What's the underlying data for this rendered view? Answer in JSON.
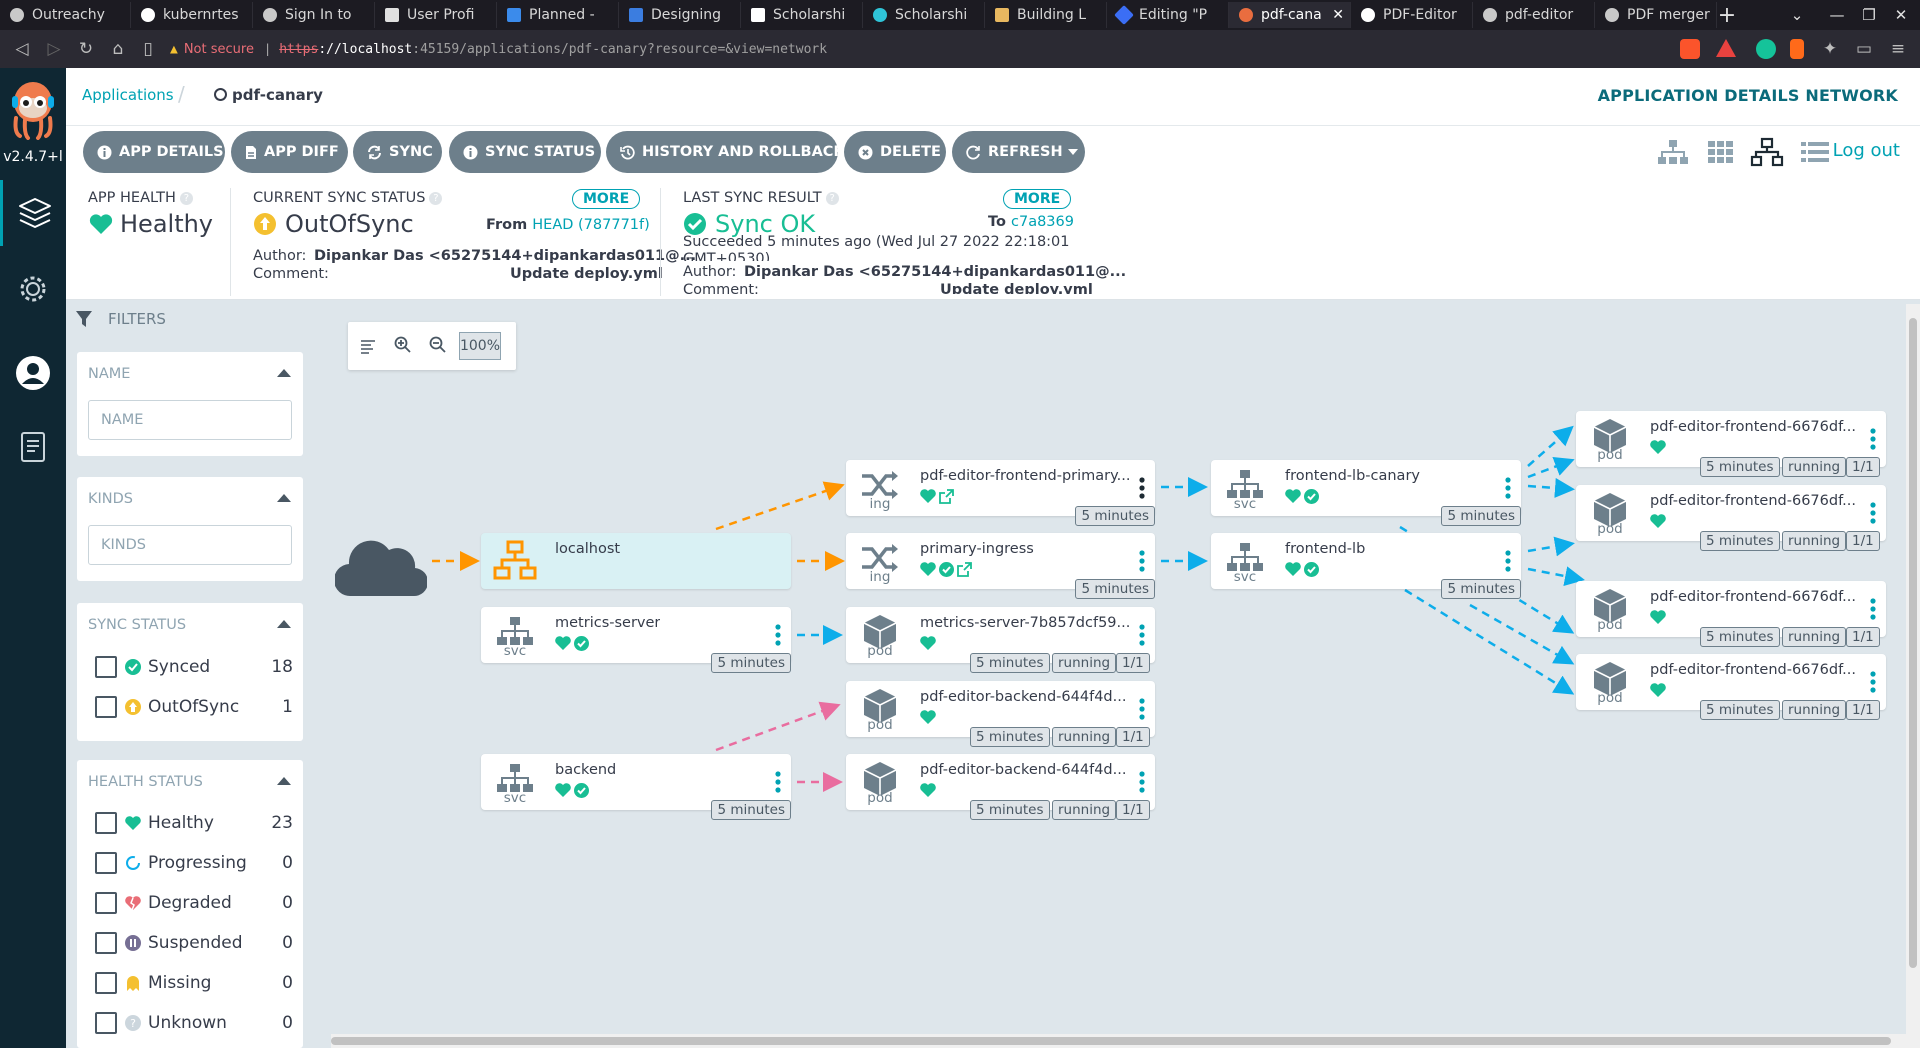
{
  "browser": {
    "tabs": [
      {
        "label": "Outreachy"
      },
      {
        "label": "kubernrtes"
      },
      {
        "label": "Sign In to"
      },
      {
        "label": "User Profi"
      },
      {
        "label": "Planned -"
      },
      {
        "label": "Designing"
      },
      {
        "label": "Scholarshi"
      },
      {
        "label": "Scholarshi"
      },
      {
        "label": "Building L"
      },
      {
        "label": "Editing \"P"
      },
      {
        "label": "pdf-cana"
      },
      {
        "label": "PDF-Editor"
      },
      {
        "label": "pdf-editor"
      },
      {
        "label": "PDF merger"
      }
    ],
    "security_label": "Not secure",
    "url_scheme": "https",
    "url_host": "://localhost",
    "url_rest": ":45159/applications/pdf-canary?resource=&view=network"
  },
  "sidebar": {
    "version": "v2.4.7+l",
    "items": [
      {
        "icon": "layers-icon"
      },
      {
        "icon": "settings-gear-icon"
      },
      {
        "icon": "user-icon"
      },
      {
        "icon": "docs-icon"
      }
    ]
  },
  "header": {
    "breadcrumb_root": "Applications",
    "breadcrumb_sep": "/",
    "app_name": "pdf-canary",
    "view_title": "APPLICATION DETAILS NETWORK",
    "logout": "Log out"
  },
  "toolbar": {
    "buttons": [
      {
        "label": "APP DETAILS",
        "icon": "info-icon"
      },
      {
        "label": "APP DIFF",
        "icon": "file-icon"
      },
      {
        "label": "SYNC",
        "icon": "sync-icon"
      },
      {
        "label": "SYNC STATUS",
        "icon": "info-icon"
      },
      {
        "label": "HISTORY AND ROLLBACK",
        "icon": "history-icon"
      },
      {
        "label": "DELETE",
        "icon": "close-circle-icon"
      },
      {
        "label": "REFRESH",
        "icon": "refresh-icon"
      }
    ]
  },
  "status": {
    "app_health_label": "APP HEALTH",
    "app_health_value": "Healthy",
    "sync_label": "CURRENT SYNC STATUS",
    "sync_value": "OutOfSync",
    "sync_more": "MORE",
    "sync_from_prefix": "From",
    "sync_from_ref": "HEAD (787771f)",
    "sync_author_label": "Author:",
    "sync_author": "Dipankar Das <65275144+dipankardas011@...",
    "sync_comment_label": "Comment:",
    "sync_comment": "Update deploy.yml",
    "last_label": "LAST SYNC RESULT",
    "last_value": "Sync OK",
    "last_more": "MORE",
    "last_to_prefix": "To",
    "last_to_ref": "c7a8369",
    "last_succeeded": "Succeeded 5 minutes ago (Wed Jul 27 2022 22:18:01",
    "last_succeeded_tz": "GMT+0530)",
    "last_author_label": "Author:",
    "last_author": "Dipankar Das <65275144+dipankardas011@...",
    "last_comment_label": "Comment:",
    "last_comment": "Update deploy.yml"
  },
  "filters": {
    "title": "FILTERS",
    "name_header": "NAME",
    "name_placeholder": "NAME",
    "kinds_header": "KINDS",
    "kinds_placeholder": "KINDS",
    "sync_header": "SYNC STATUS",
    "sync_items": [
      {
        "label": "Synced",
        "count": "18"
      },
      {
        "label": "OutOfSync",
        "count": "1"
      }
    ],
    "health_header": "HEALTH STATUS",
    "health_items": [
      {
        "label": "Healthy",
        "count": "23"
      },
      {
        "label": "Progressing",
        "count": "0"
      },
      {
        "label": "Degraded",
        "count": "0"
      },
      {
        "label": "Suspended",
        "count": "0"
      },
      {
        "label": "Missing",
        "count": "0"
      },
      {
        "label": "Unknown",
        "count": "0"
      }
    ]
  },
  "graph": {
    "zoom": "100%",
    "nodes": [
      {
        "name": "localhost",
        "kind": "",
        "age": "",
        "status": "",
        "ready": ""
      },
      {
        "name": "metrics-server",
        "kind": "svc",
        "age": "5 minutes",
        "status": "",
        "ready": ""
      },
      {
        "name": "backend",
        "kind": "svc",
        "age": "5 minutes",
        "status": "",
        "ready": ""
      },
      {
        "name": "pdf-editor-frontend-primary...",
        "kind": "ing",
        "age": "5 minutes",
        "status": "",
        "ready": ""
      },
      {
        "name": "primary-ingress",
        "kind": "ing",
        "age": "5 minutes",
        "status": "",
        "ready": ""
      },
      {
        "name": "metrics-server-7b857dcf59...",
        "kind": "pod",
        "age": "5 minutes",
        "status": "running",
        "ready": "1/1"
      },
      {
        "name": "pdf-editor-backend-644f4d...",
        "kind": "pod",
        "age": "5 minutes",
        "status": "running",
        "ready": "1/1"
      },
      {
        "name": "pdf-editor-backend-644f4d...",
        "kind": "pod",
        "age": "5 minutes",
        "status": "running",
        "ready": "1/1"
      },
      {
        "name": "frontend-lb-canary",
        "kind": "svc",
        "age": "5 minutes",
        "status": "",
        "ready": ""
      },
      {
        "name": "frontend-lb",
        "kind": "svc",
        "age": "5 minutes",
        "status": "",
        "ready": ""
      },
      {
        "name": "pdf-editor-frontend-6676df...",
        "kind": "pod",
        "age": "5 minutes",
        "status": "running",
        "ready": "1/1"
      },
      {
        "name": "pdf-editor-frontend-6676df...",
        "kind": "pod",
        "age": "5 minutes",
        "status": "running",
        "ready": "1/1"
      },
      {
        "name": "pdf-editor-frontend-6676df...",
        "kind": "pod",
        "age": "5 minutes",
        "status": "running",
        "ready": "1/1"
      },
      {
        "name": "pdf-editor-frontend-6676df...",
        "kind": "pod",
        "age": "5 minutes",
        "status": "running",
        "ready": "1/1"
      }
    ]
  },
  "colors": {
    "accent": "#00a2b3",
    "healthy": "#18be94",
    "outofsync": "#f4c030",
    "degraded": "#e96d76",
    "suspended": "#766f94",
    "edge_teal": "#0dadea",
    "edge_orange": "#ff9500",
    "edge_pink": "#e96d9f"
  }
}
